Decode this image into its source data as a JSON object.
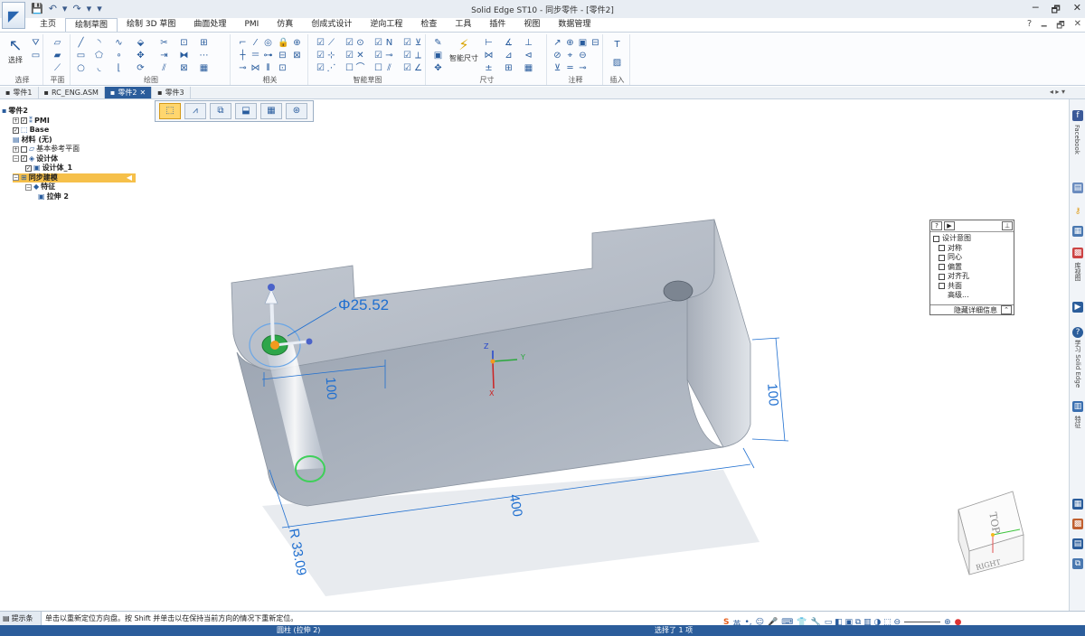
{
  "app": {
    "title": "Solid Edge ST10 - 同步零件 - [零件2]",
    "window_controls": [
      "─",
      "🗗",
      "✕"
    ]
  },
  "qat": [
    "💾",
    "↶",
    "▾",
    "↷",
    "▾",
    "▾"
  ],
  "help_icons": [
    "?",
    "🗕",
    "🗗",
    "✕"
  ],
  "ribbon_tabs": [
    {
      "label": "主页",
      "active": false
    },
    {
      "label": "绘制草图",
      "active": true
    },
    {
      "label": "绘制 3D 草图",
      "active": false
    },
    {
      "label": "曲面处理",
      "active": false
    },
    {
      "label": "PMI",
      "active": false
    },
    {
      "label": "仿真",
      "active": false
    },
    {
      "label": "创成式设计",
      "active": false
    },
    {
      "label": "逆向工程",
      "active": false
    },
    {
      "label": "检查",
      "active": false
    },
    {
      "label": "工具",
      "active": false
    },
    {
      "label": "插件",
      "active": false
    },
    {
      "label": "视图",
      "active": false
    },
    {
      "label": "数据管理",
      "active": false
    }
  ],
  "ribbon_groups": {
    "select": "选择",
    "select_btn": "选择",
    "plane": "平面",
    "draw": "绘图",
    "relate": "相关",
    "intelli": "智能草图",
    "dimension": "尺寸",
    "smart_dim": "智能尺寸",
    "annotation": "注释",
    "insert": "插入"
  },
  "doc_tabs": [
    {
      "label": "零件1",
      "active": false
    },
    {
      "label": "RC_ENG.ASM",
      "active": false
    },
    {
      "label": "零件2",
      "active": true
    },
    {
      "label": "零件3",
      "active": false
    }
  ],
  "doc_tab_nav": "◂ ▸ ▾",
  "tree": [
    {
      "label": "零件2",
      "bold": true,
      "indent": 0,
      "pm": "",
      "cb": "",
      "icon": "▪"
    },
    {
      "label": "PMI",
      "bold": true,
      "indent": 1,
      "pm": "+",
      "cb": "✓",
      "icon": "⁑"
    },
    {
      "label": "Base",
      "bold": true,
      "indent": 1,
      "pm": "",
      "cb": "✓",
      "icon": "⬚"
    },
    {
      "label": "材料 (无)",
      "bold": true,
      "indent": 1,
      "pm": "",
      "cb": "",
      "icon": "▤"
    },
    {
      "label": "基本参考平面",
      "bold": false,
      "indent": 1,
      "pm": "+",
      "cb": " ",
      "icon": "▱"
    },
    {
      "label": "设计体",
      "bold": true,
      "indent": 1,
      "pm": "−",
      "cb": "✓",
      "icon": "◈"
    },
    {
      "label": "设计体_1",
      "bold": true,
      "indent": 2,
      "pm": "",
      "cb": "✓",
      "icon": "▣"
    },
    {
      "label": "同步建模",
      "bold": true,
      "indent": 1,
      "pm": "−",
      "cb": "",
      "icon": "⊞",
      "selected": true
    },
    {
      "label": "特征",
      "bold": true,
      "indent": 2,
      "pm": "−",
      "cb": "",
      "icon": "◆"
    },
    {
      "label": "拉伸 2",
      "bold": true,
      "indent": 3,
      "pm": "",
      "cb": "",
      "icon": "▣"
    }
  ],
  "command_bar": [
    "⬚",
    "⩘",
    "⧉",
    "⬓",
    "▦",
    "⊛"
  ],
  "dimensions": {
    "diameter": "Φ25.52",
    "width": "100",
    "height": "100",
    "length": "400",
    "radius": "R 33.09"
  },
  "triad_axes": {
    "z": "Z",
    "y": "Y",
    "x": "X"
  },
  "view_cube": {
    "top": "TOP",
    "right": "RIGHT"
  },
  "design_intent": {
    "header": "设计意图",
    "items": [
      "对称",
      "同心",
      "偏置",
      "对齐孔",
      "共面"
    ],
    "advanced": "高级...",
    "toggle": "隐藏详细信息",
    "btns": [
      "?",
      "▶",
      "⊥"
    ]
  },
  "right_dock": {
    "facebook": "Facebook",
    "library": "库视图",
    "learn": "学习 Solid Edge",
    "properties": "特征"
  },
  "prompt": {
    "label": "提示条",
    "text": "单击以重新定位方向盘。按 Shift 并单击以在保持当前方向的情况下重新定位。"
  },
  "status": {
    "left": "圆柱 (拉伸 2)",
    "middle": "选择了 1 项",
    "ime": "英"
  },
  "colors": {
    "accent": "#2b5d9b",
    "body_gray": "#a9b1bd",
    "dim_blue": "#1f6fd0",
    "selected": "#f6c04a"
  }
}
